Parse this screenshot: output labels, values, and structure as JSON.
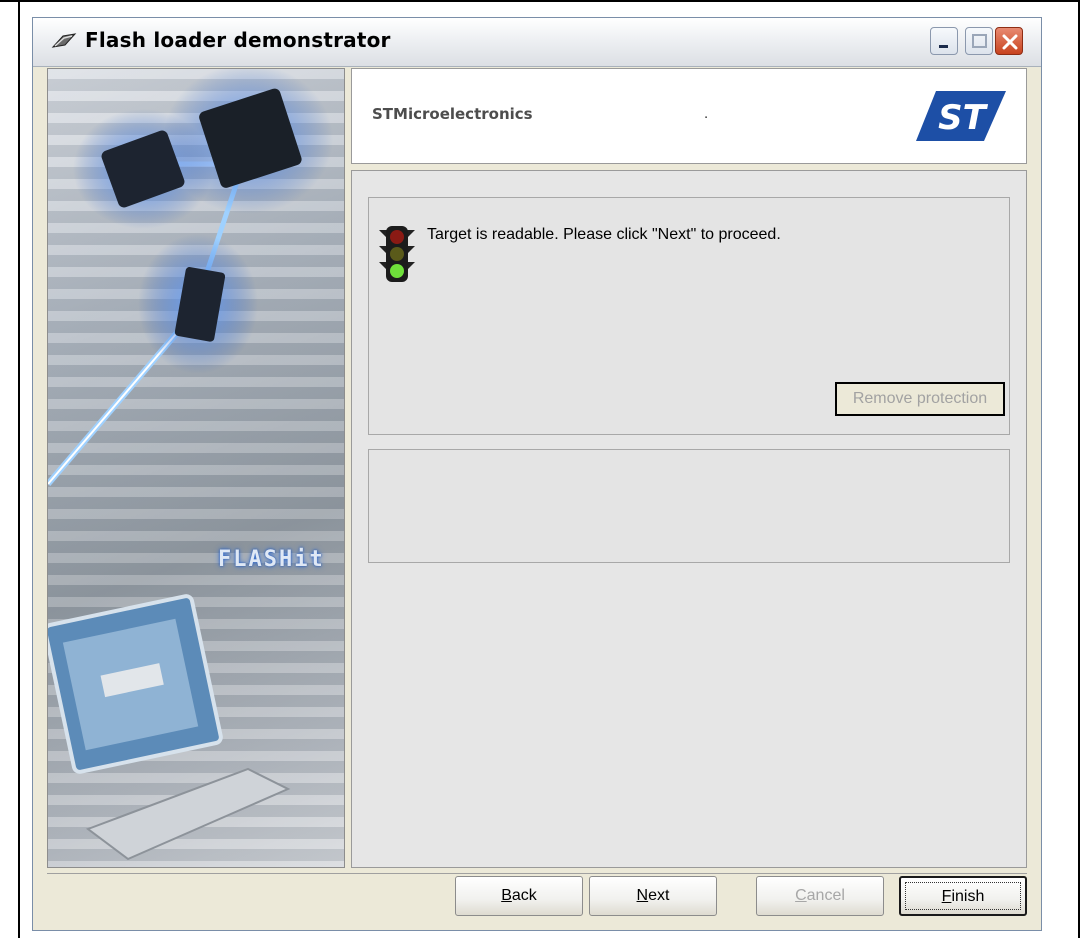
{
  "window": {
    "title": "Flash loader demonstrator"
  },
  "header": {
    "brand": "STMicroelectronics",
    "dot": ".",
    "logo_text": "ST"
  },
  "side_image": {
    "text": "FLASHit"
  },
  "status": {
    "message": "Target is readable. Please click \"Next\" to proceed.",
    "remove_protection_label": "Remove protection"
  },
  "footer": {
    "back_label": "Back",
    "next_label": "Next",
    "cancel_label": "Cancel",
    "finish_label": "Finish"
  },
  "colors": {
    "window_bg": "#ece9d8",
    "panel_bg": "#e6e6e6",
    "st_blue": "#1d4fa6",
    "disabled_text": "#a2a2a2"
  }
}
